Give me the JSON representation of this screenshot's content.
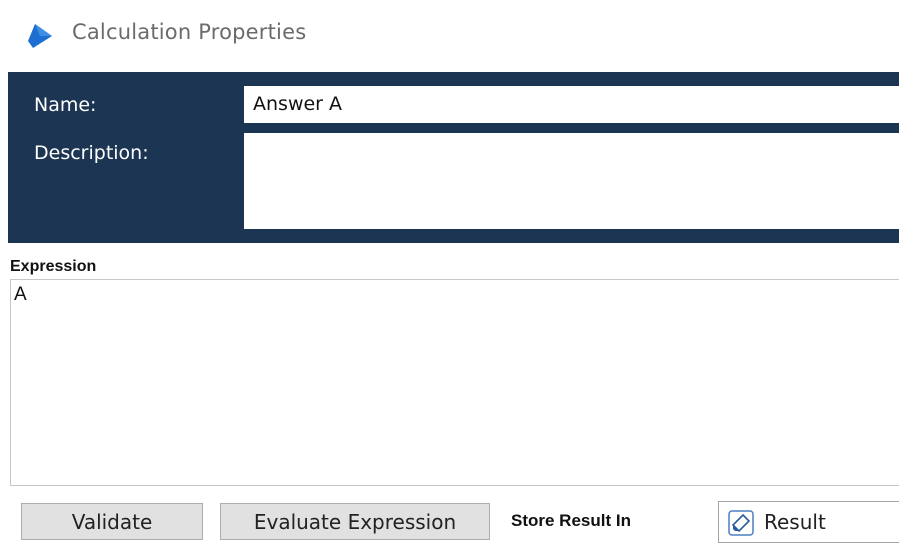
{
  "window": {
    "title": "Calculation Properties",
    "icon": "calculation-app-icon"
  },
  "properties": {
    "name_label": "Name:",
    "name_value": "Answer A",
    "description_label": "Description:",
    "description_value": ""
  },
  "expression": {
    "label": "Expression",
    "value": "A"
  },
  "footer": {
    "validate_label": "Validate",
    "evaluate_label": "Evaluate Expression",
    "store_label": "Store Result In",
    "store_value": "Result",
    "store_icon": "variable-icon"
  },
  "colors": {
    "header_bg": "#1b3553",
    "app_icon": "#1c6fd1"
  }
}
